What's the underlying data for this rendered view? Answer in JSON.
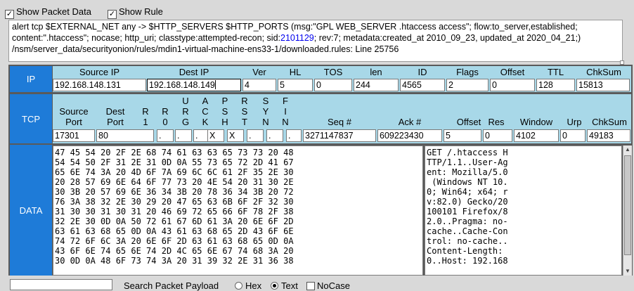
{
  "toolbar": {
    "show_packet_data": "Show Packet Data",
    "show_rule": "Show Rule"
  },
  "alert": {
    "line1": "alert tcp $EXTERNAL_NET any -> $HTTP_SERVERS $HTTP_PORTS (msg:\"GPL WEB_SERVER .htaccess access\"; flow:to_server,established;",
    "line2_before": "content:\".htaccess\"; nocase; http_uri; classtype:attempted-recon; sid:",
    "sid": "2101129",
    "line2_after": "; rev:7; metadata:created_at 2010_09_23, updated_at 2020_04_21;)",
    "line3": "/nsm/server_data/securityonion/rules/mdin1-virtual-machine-ens33-1/downloaded.rules: Line 25756"
  },
  "ip": {
    "header": "IP",
    "labels": {
      "source_ip": "Source IP",
      "dest_ip": "Dest IP",
      "ver": "Ver",
      "hl": "HL",
      "tos": "TOS",
      "len": "len",
      "id": "ID",
      "flags": "Flags",
      "offset": "Offset",
      "ttl": "TTL",
      "chksum": "ChkSum"
    },
    "values": {
      "source_ip": "192.168.148.131",
      "dest_ip": "192.168.148.149",
      "ver": "4",
      "hl": "5",
      "tos": "0",
      "len": "244",
      "id": "4565",
      "flags": "2",
      "offset": "0",
      "ttl": "128",
      "chksum": "15813"
    }
  },
  "tcp": {
    "header": "TCP",
    "labels": {
      "source_port_1": "Source",
      "source_port_2": "Port",
      "dest_port_1": "Dest",
      "dest_port_2": "Port",
      "r1_1": "R",
      "r1_2": "1",
      "r0_1": "R",
      "r0_2": "0",
      "urg": [
        "U",
        "R",
        "G"
      ],
      "ack": [
        "A",
        "C",
        "K"
      ],
      "psh": [
        "P",
        "S",
        "H"
      ],
      "rst": [
        "R",
        "S",
        "T"
      ],
      "syn": [
        "S",
        "Y",
        "N"
      ],
      "fin": [
        "F",
        "I",
        "N"
      ],
      "seq": "Seq #",
      "ack_num": "Ack #",
      "offset": "Offset",
      "res": "Res",
      "window": "Window",
      "urp": "Urp",
      "chksum": "ChkSum"
    },
    "values": {
      "source_port": "17301",
      "dest_port": "80",
      "r1": ".",
      "r0": ".",
      "urg": ".",
      "ack": "X",
      "psh": "X",
      "rst": ".",
      "syn": ".",
      "fin": ".",
      "seq": "3271147837",
      "ack_num": "609223430",
      "offset": "5",
      "res": "0",
      "window": "4102",
      "urp": "0",
      "chksum": "49183"
    }
  },
  "data": {
    "header": "DATA",
    "hex": "47 45 54 20 2F 2E 68 74 61 63 63 65 73 73 20 48\n54 54 50 2F 31 2E 31 0D 0A 55 73 65 72 2D 41 67\n65 6E 74 3A 20 4D 6F 7A 69 6C 6C 61 2F 35 2E 30\n20 28 57 69 6E 64 6F 77 73 20 4E 54 20 31 30 2E\n30 3B 20 57 69 6E 36 34 3B 20 78 36 34 3B 20 72\n76 3A 38 32 2E 30 29 20 47 65 63 6B 6F 2F 32 30\n31 30 30 31 30 31 20 46 69 72 65 66 6F 78 2F 38\n32 2E 30 0D 0A 50 72 61 67 6D 61 3A 20 6E 6F 2D\n63 61 63 68 65 0D 0A 43 61 63 68 65 2D 43 6F 6E\n74 72 6F 6C 3A 20 6E 6F 2D 63 61 63 68 65 0D 0A\n43 6F 6E 74 65 6E 74 2D 4C 65 6E 67 74 68 3A 20\n30 0D 0A 48 6F 73 74 3A 20 31 39 32 2E 31 36 38",
    "ascii": "GET /.htaccess H\nTTP/1.1..User-Ag\nent: Mozilla/5.0\n (Windows NT 10.\n0; Win64; x64; r\nv:82.0) Gecko/20\n100101 Firefox/8\n2.0..Pragma: no-\ncache..Cache-Con\ntrol: no-cache..\nContent-Length:\n0..Host: 192.168"
  },
  "search": {
    "label": "Search Packet Payload",
    "hex": "Hex",
    "text": "Text",
    "nocase": "NoCase"
  }
}
